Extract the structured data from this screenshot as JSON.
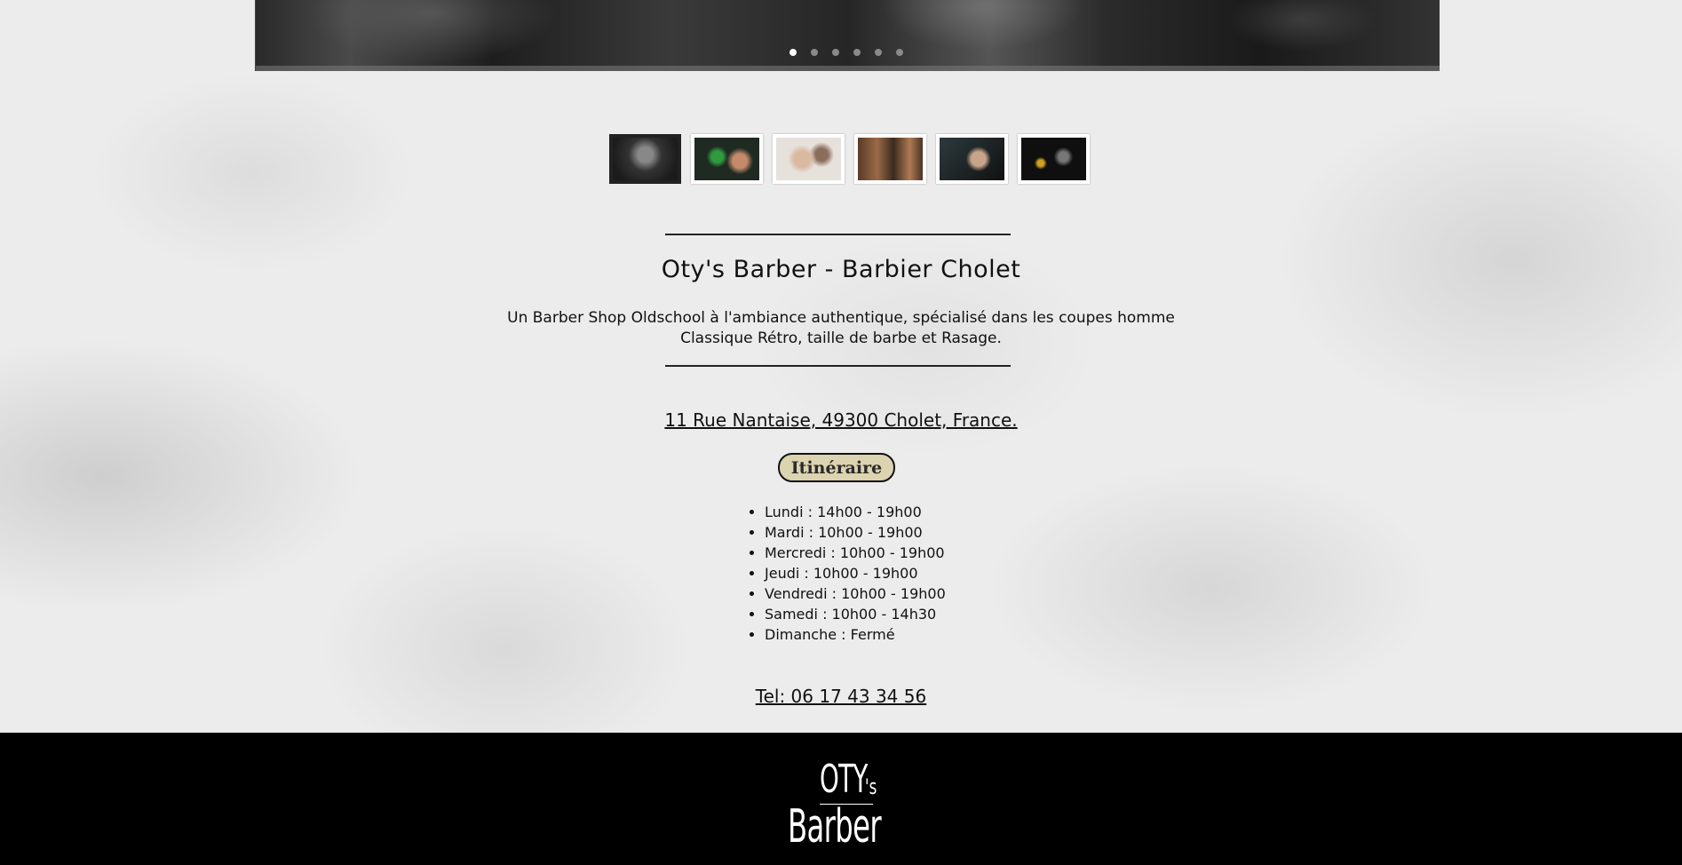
{
  "slideshow": {
    "dot_count": 6,
    "active_index": 0,
    "thumbnails": [
      "thumb-1",
      "thumb-2",
      "thumb-3",
      "thumb-4",
      "thumb-5",
      "thumb-6"
    ]
  },
  "content": {
    "title": "Oty's Barber - Barbier Cholet",
    "description": "Un Barber Shop Oldschool à l'ambiance authentique, spécialisé dans les coupes homme Classique Rétro, taille de barbe et Rasage.",
    "address": "11 Rue Nantaise, 49300 Cholet, France.",
    "itinerary_label": "Itinéraire",
    "hours": [
      "Lundi : 14h00 - 19h00",
      "Mardi : 10h00 - 19h00",
      "Mercredi : 10h00 - 19h00",
      "Jeudi : 10h00 - 19h00",
      "Vendredi : 10h00 - 19h00",
      "Samedi : 10h00 - 14h30",
      "Dimanche : Fermé"
    ],
    "phone": "Tel: 06 17 43 34 56"
  },
  "footer": {
    "logo_line1": "OTY",
    "logo_suffix": "'s",
    "logo_line2": "Barber"
  },
  "colors": {
    "button_bg": "#dcd3b0",
    "footer_bg": "#000000",
    "page_bg": "#ececec"
  }
}
